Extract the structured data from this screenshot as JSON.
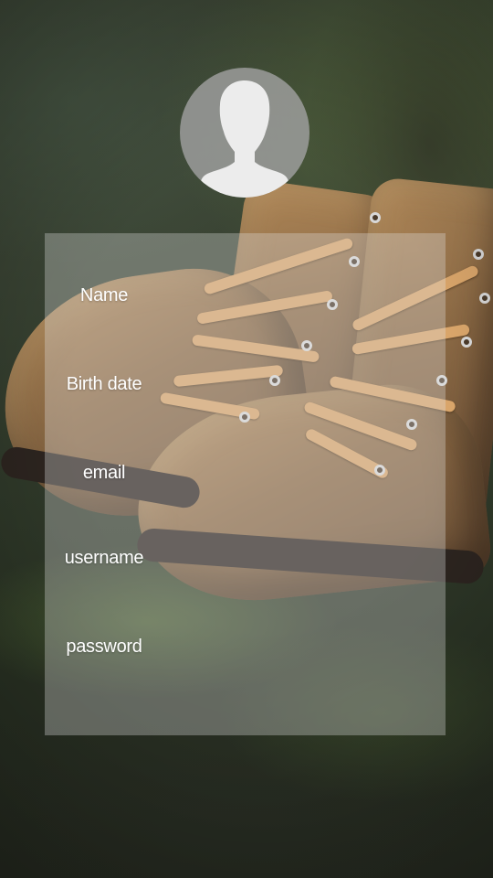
{
  "form": {
    "fields": [
      {
        "label": "Name"
      },
      {
        "label": "Birth date"
      },
      {
        "label": "email"
      },
      {
        "label": "username"
      },
      {
        "label": "password"
      }
    ]
  },
  "avatar": {
    "icon": "user-silhouette-icon"
  },
  "colors": {
    "panel_overlay": "#e1e1e1",
    "label_text": "#ffffff",
    "avatar_bg": "#a0a0a0",
    "avatar_figure": "#ececec"
  }
}
